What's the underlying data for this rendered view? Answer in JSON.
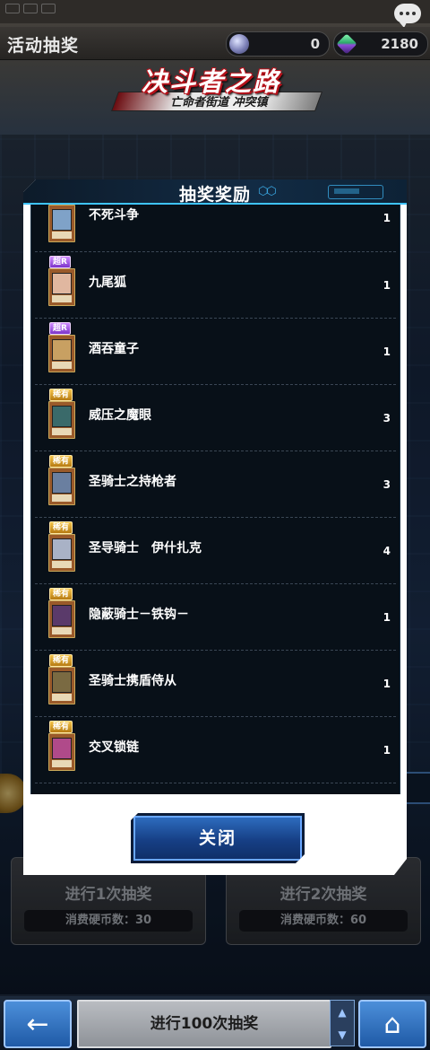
{
  "header": {
    "screen_title": "活动抽奖",
    "currency_orb": "0",
    "currency_gem": "2180"
  },
  "banner": {
    "title": "决斗者之路",
    "subtitle": "亡命者街道 冲突镇"
  },
  "draw_panels": [
    {
      "label": "进行1次抽奖",
      "cost": "消费硬币数：30"
    },
    {
      "label": "进行2次抽奖",
      "cost": "消费硬币数：60"
    }
  ],
  "bottom_bar": {
    "bulk_draw_label": "进行100次抽奖",
    "back_icon": "←",
    "home_icon": "⌂"
  },
  "modal": {
    "title": "抽奖奖励",
    "close_label": "关闭",
    "items": [
      {
        "name": "不死斗争",
        "qty": "1",
        "rarity": "",
        "art": "#7fa2c8"
      },
      {
        "name": "九尾狐",
        "qty": "1",
        "rarity": "超R",
        "art": "#e0b7a0"
      },
      {
        "name": "酒吞童子",
        "qty": "1",
        "rarity": "超R",
        "art": "#c8a062"
      },
      {
        "name": "威压之魔眼",
        "qty": "3",
        "rarity": "稀有",
        "art": "#3a6a6a"
      },
      {
        "name": "圣骑士之持枪者",
        "qty": "3",
        "rarity": "稀有",
        "art": "#6a7fa0"
      },
      {
        "name": "圣导骑士　伊什扎克",
        "qty": "4",
        "rarity": "稀有",
        "art": "#a9b2c6"
      },
      {
        "name": "隐蔽骑士－铁钩－",
        "qty": "1",
        "rarity": "稀有",
        "art": "#5a3a6a"
      },
      {
        "name": "圣骑士携盾侍从",
        "qty": "1",
        "rarity": "稀有",
        "art": "#7a6a42"
      },
      {
        "name": "交叉锁链",
        "qty": "1",
        "rarity": "稀有",
        "art": "#b04a8a"
      },
      {
        "name": "",
        "qty": "",
        "rarity": "",
        "art": "#3a4a6a"
      }
    ]
  }
}
